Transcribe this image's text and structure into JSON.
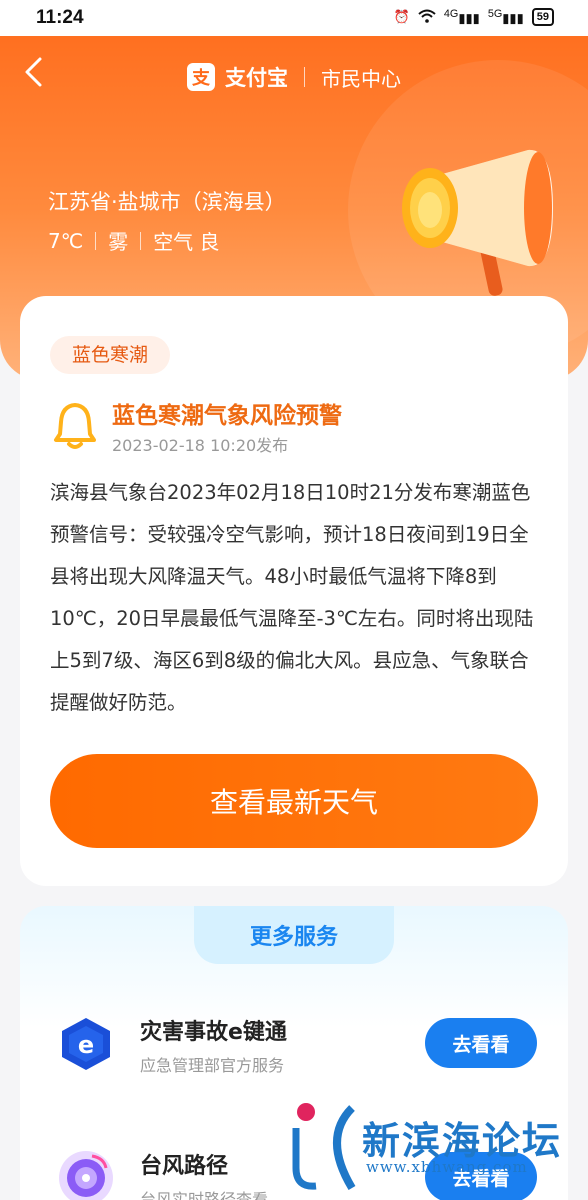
{
  "status_bar": {
    "time": "11:24",
    "signal_1": "4G",
    "signal_2": "5G",
    "battery": "59"
  },
  "nav": {
    "brand_logo_text": "支",
    "brand_name": "支付宝",
    "section": "市民中心"
  },
  "hero": {
    "location": "江苏省·盐城市（滨海县）",
    "temperature": "7℃",
    "weather": "雾",
    "air_quality": "空气 良"
  },
  "alert": {
    "tag": "蓝色寒潮",
    "title": "蓝色寒潮气象风险预警",
    "published": "2023-02-18 10:20发布",
    "body": "滨海县气象台2023年02月18日10时21分发布寒潮蓝色预警信号：受较强冷空气影响，预计18日夜间到19日全县将出现大风降温天气。48小时最低气温将下降8到10℃，20日早晨最低气温降至-3℃左右。同时将出现陆上5到7级、海区6到8级的偏北大风。县应急、气象联合提醒做好防范。",
    "button_label": "查看最新天气"
  },
  "services": {
    "title": "更多服务",
    "items": [
      {
        "name": "灾害事故e键通",
        "desc": "应急管理部官方服务",
        "button": "去看看"
      },
      {
        "name": "台风路径",
        "desc": "台风实时路径查看",
        "button": "去看看"
      }
    ]
  },
  "watermark": {
    "text": "新滨海论坛",
    "url": "www.xbhwang.com"
  },
  "colors": {
    "accent": "#ff6a1a",
    "service_blue": "#1a7ff0",
    "alert_title": "#ee6a12"
  }
}
